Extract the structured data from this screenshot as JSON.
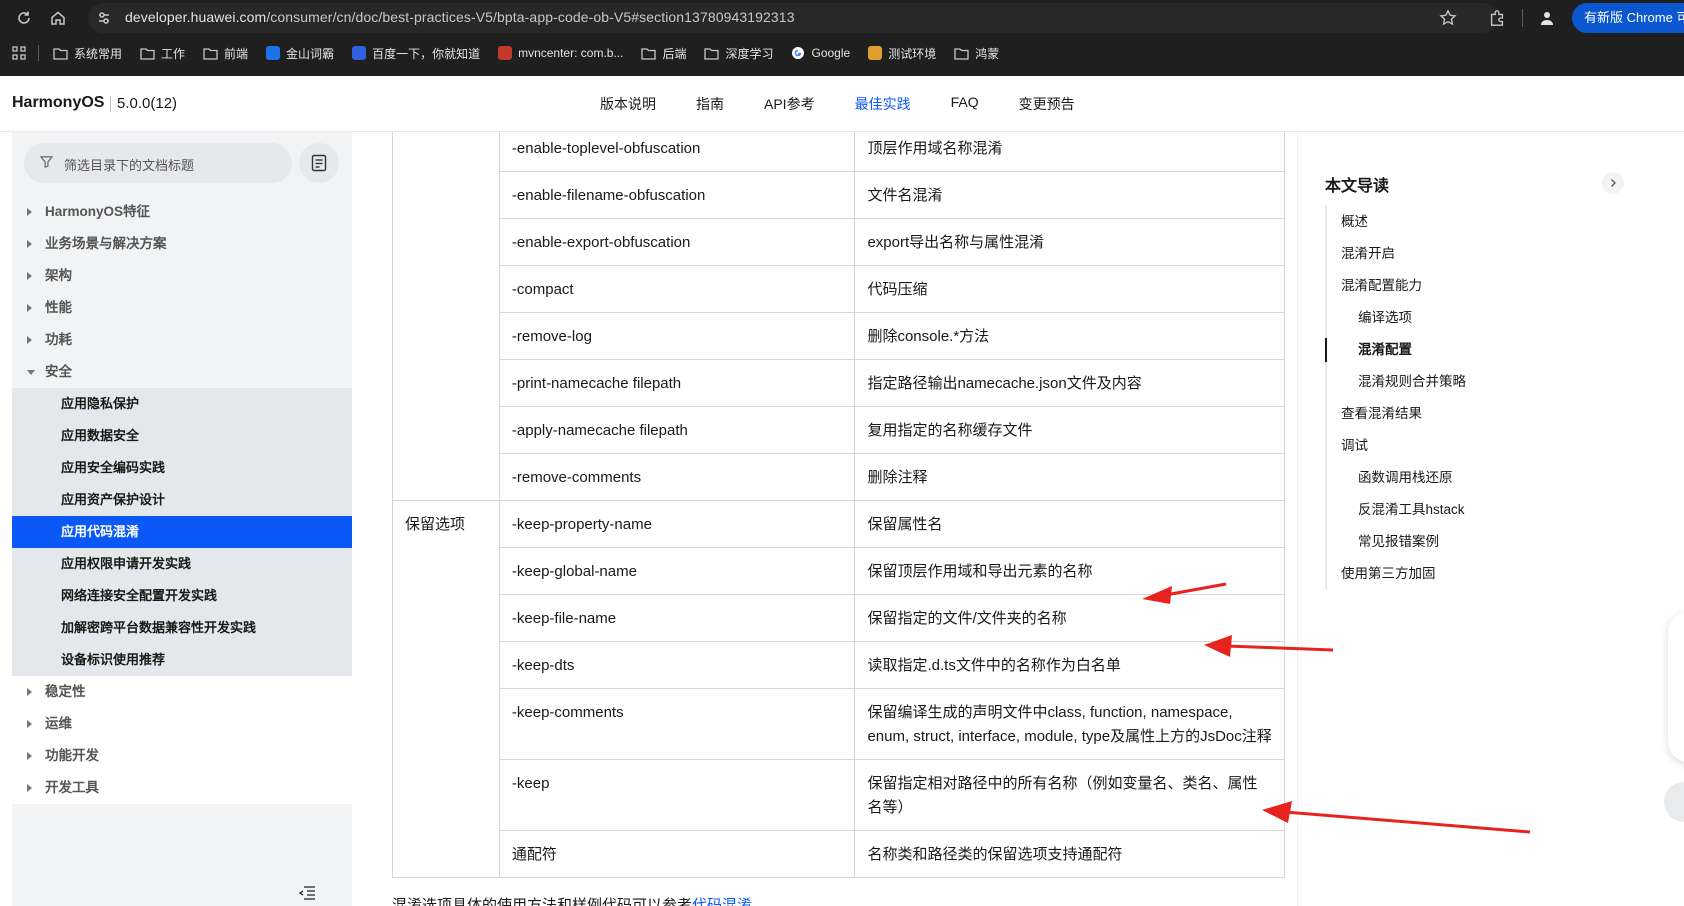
{
  "browser": {
    "url_host": "developer.huawei.com",
    "url_path": "/consumer/cn/doc/best-practices-V5/bpta-app-code-ob-V5#section13780943192313",
    "update_label": "有新版 Chrome 可",
    "bookmarks": [
      {
        "label": "系统常用",
        "icon": "folder-icon"
      },
      {
        "label": "工作",
        "icon": "folder-icon"
      },
      {
        "label": "前端",
        "icon": "folder-icon"
      },
      {
        "label": "金山词霸",
        "icon": "iciba-icon",
        "color": "#1a73e8"
      },
      {
        "label": "百度一下，你就知道",
        "icon": "baidu-icon",
        "color": "#3060e0"
      },
      {
        "label": "mvncenter: com.b...",
        "icon": "mvn-icon",
        "color": "#c0392b"
      },
      {
        "label": "后端",
        "icon": "folder-icon"
      },
      {
        "label": "深度学习",
        "icon": "folder-icon"
      },
      {
        "label": "Google",
        "icon": "google-icon"
      },
      {
        "label": "测试环境",
        "icon": "wheat-icon",
        "color": "#e0a030"
      },
      {
        "label": "鸿蒙",
        "icon": "folder-icon"
      }
    ]
  },
  "header": {
    "brand": "HarmonyOS",
    "version": "5.0.0(12)",
    "nav": [
      "版本说明",
      "指南",
      "API参考",
      "最佳实践",
      "FAQ",
      "变更预告"
    ],
    "active_nav": "最佳实践"
  },
  "sidebar": {
    "search_placeholder": "筛选目录下的文档标题",
    "top_items": [
      "HarmonyOS特征",
      "业务场景与解决方案",
      "架构",
      "性能",
      "功耗"
    ],
    "open_item": "安全",
    "sub_items": [
      "应用隐私保护",
      "应用数据安全",
      "应用安全编码实践",
      "应用资产保护设计",
      "应用代码混淆",
      "应用权限申请开发实践",
      "网络连接安全配置开发实践",
      "加解密跨平台数据兼容性开发实践",
      "设备标识使用推荐"
    ],
    "active_sub": "应用代码混淆",
    "bottom_items": [
      "稳定性",
      "运维",
      "功能开发",
      "开发工具"
    ]
  },
  "table": {
    "group1_rows": [
      {
        "option": "-enable-toplevel-obfuscation",
        "desc": "顶层作用域名称混淆"
      },
      {
        "option": "-enable-filename-obfuscation",
        "desc": "文件名混淆"
      },
      {
        "option": "-enable-export-obfuscation",
        "desc": "export导出名称与属性混淆"
      },
      {
        "option": "-compact",
        "desc": "代码压缩"
      },
      {
        "option": "-remove-log",
        "desc": "删除console.*方法"
      },
      {
        "option": "-print-namecache filepath",
        "desc": "指定路径输出namecache.json文件及内容"
      },
      {
        "option": "-apply-namecache filepath",
        "desc": "复用指定的名称缓存文件"
      },
      {
        "option": "-remove-comments",
        "desc": "删除注释"
      }
    ],
    "group2_label": "保留选项",
    "group2_rows": [
      {
        "option": "-keep-property-name",
        "desc": "保留属性名"
      },
      {
        "option": "-keep-global-name",
        "desc": "保留顶层作用域和导出元素的名称"
      },
      {
        "option": "-keep-file-name",
        "desc": "保留指定的文件/文件夹的名称"
      },
      {
        "option": "-keep-dts",
        "desc": "读取指定.d.ts文件中的名称作为白名单"
      },
      {
        "option": "-keep-comments",
        "desc": "保留编译生成的声明文件中class, function, namespace, enum, struct, interface, module, type及属性上方的JsDoc注释"
      },
      {
        "option": "-keep",
        "desc": "保留指定相对路径中的所有名称（例如变量名、类名、属性名等）"
      },
      {
        "option": "通配符",
        "desc": "名称类和路径类的保留选项支持通配符"
      }
    ],
    "after_text": "混淆选项具体的使用方法和样例代码可以参考",
    "after_link": "代码混淆"
  },
  "toc": {
    "title": "本文导读",
    "items": [
      {
        "label": "概述",
        "level": 1
      },
      {
        "label": "混淆开启",
        "level": 1
      },
      {
        "label": "混淆配置能力",
        "level": 1
      },
      {
        "label": "编译选项",
        "level": 2
      },
      {
        "label": "混淆配置",
        "level": 2,
        "active": true
      },
      {
        "label": "混淆规则合并策略",
        "level": 2
      },
      {
        "label": "查看混淆结果",
        "level": 1
      },
      {
        "label": "调试",
        "level": 1
      },
      {
        "label": "函数调用栈还原",
        "level": 2
      },
      {
        "label": "反混淆工具hstack",
        "level": 2
      },
      {
        "label": "常见报错案例",
        "level": 2
      },
      {
        "label": "使用第三方加固",
        "level": 1
      }
    ]
  },
  "colors": {
    "accent": "#0a59f7",
    "annotation_arrow": "#e8231e"
  }
}
